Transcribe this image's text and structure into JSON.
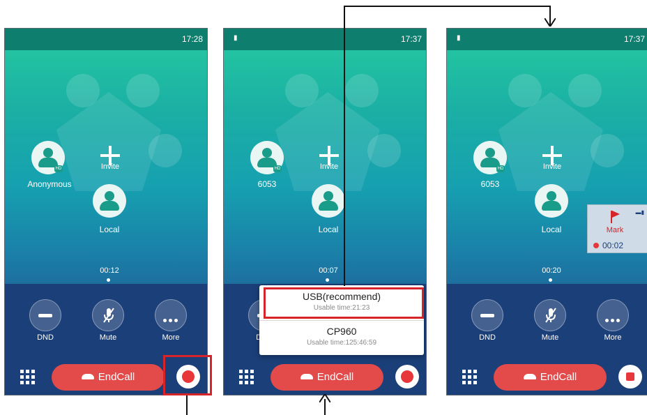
{
  "screens": [
    {
      "time": "17:28",
      "invite_label": "Invite",
      "remote_name": "Anonymous",
      "local_name": "Local",
      "duration": "00:12",
      "actions": [
        {
          "label": "DND"
        },
        {
          "label": "Mute"
        },
        {
          "label": "More"
        }
      ],
      "endcall_label": "EndCall",
      "record_icon": "record-icon"
    },
    {
      "time": "17:37",
      "usb_indicator": "usb-icon",
      "invite_label": "Invite",
      "remote_name": "6053",
      "local_name": "Local",
      "duration": "00:07",
      "actions": [
        {
          "label": "DND"
        }
      ],
      "endcall_label": "EndCall",
      "popup": [
        {
          "title": "USB(recommend)",
          "subtitle": "Usable time:21:23"
        },
        {
          "title": "CP960",
          "subtitle": "Usable time:125:46:59"
        }
      ],
      "record_icon": "record-icon"
    },
    {
      "time": "17:37",
      "usb_indicator": "usb-icon",
      "invite_label": "Invite",
      "remote_name": "6053",
      "local_name": "Local",
      "duration": "00:20",
      "actions": [
        {
          "label": "DND"
        },
        {
          "label": "Mute"
        },
        {
          "label": "More"
        }
      ],
      "endcall_label": "EndCall",
      "recording_panel": {
        "mark_label": "Mark",
        "elapsed": "00:02"
      },
      "record_icon": "stop-icon"
    }
  ],
  "colors": {
    "accent_green": "#22c3a2",
    "status_bar": "#0e7f6f",
    "bottom_bar": "#1b3f78",
    "endcall_red": "#e34a4a",
    "highlight_red": "#d7232a"
  }
}
